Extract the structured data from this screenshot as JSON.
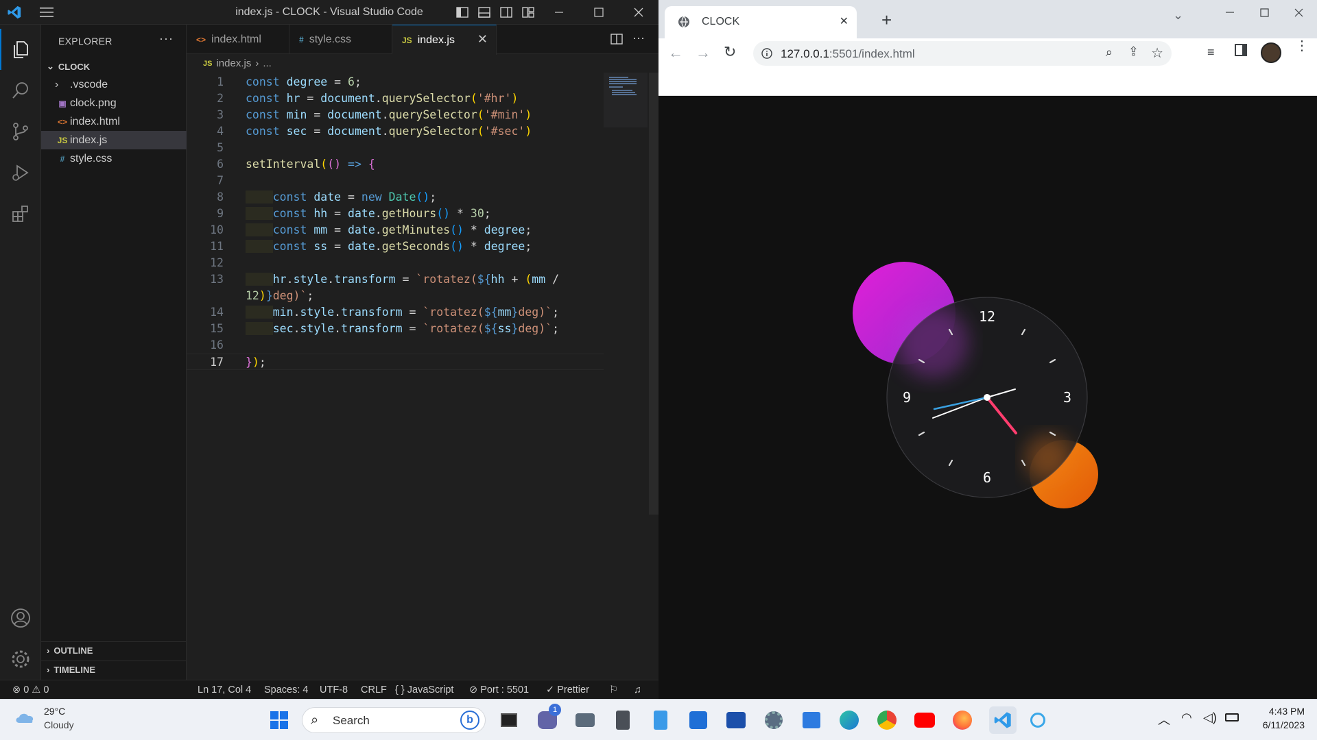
{
  "vscode": {
    "window_title": "index.js - CLOCK - Visual Studio Code",
    "sidebar": {
      "header": "EXPLORER",
      "more": "···",
      "folder": "CLOCK",
      "files": [
        {
          "name": ".vscode",
          "icon": "›",
          "color": "#cccccc"
        },
        {
          "name": "clock.png",
          "icon": "▣",
          "color": "#a074c4"
        },
        {
          "name": "index.html",
          "icon": "<>",
          "color": "#e37933"
        },
        {
          "name": "index.js",
          "icon": "JS",
          "color": "#cbcb41"
        },
        {
          "name": "style.css",
          "icon": "#",
          "color": "#519aba"
        }
      ],
      "outline": "OUTLINE",
      "timeline": "TIMELINE"
    },
    "tabs": [
      {
        "label": "index.html",
        "icon": "<>",
        "color": "#e37933"
      },
      {
        "label": "style.css",
        "icon": "#",
        "color": "#519aba"
      },
      {
        "label": "index.js",
        "icon": "JS",
        "color": "#cbcb41"
      }
    ],
    "breadcrumb": {
      "file": "index.js",
      "rest": "..."
    },
    "line_numbers": [
      "1",
      "2",
      "3",
      "4",
      "5",
      "6",
      "7",
      "8",
      "9",
      "10",
      "11",
      "12",
      "13",
      "",
      "14",
      "15",
      "16",
      "17"
    ],
    "status": {
      "errors": "0",
      "warnings": "0",
      "position": "Ln 17, Col 4",
      "spaces": "Spaces: 4",
      "encoding": "UTF-8",
      "eol": "CRLF",
      "language": "JavaScript",
      "port": "Port : 5501",
      "prettier": "Prettier"
    }
  },
  "browser": {
    "tab_title": "CLOCK",
    "url_host": "127.0.0.1",
    "url_rest": ":5501/index.html",
    "clock": {
      "numerals": [
        "12",
        "3",
        "6",
        "9"
      ]
    }
  },
  "taskbar": {
    "temp": "29°C",
    "weather": "Cloudy",
    "search": "Search",
    "time": "4:43 PM",
    "date": "6/11/2023",
    "teams_badge": "1"
  },
  "colors": {
    "accent": "#0078d4",
    "clock_purple": "#c21fd0",
    "clock_orange": "#ef6c0b",
    "second_hand": "#ff3d6e",
    "minute_hand": "#3aa0e0"
  }
}
